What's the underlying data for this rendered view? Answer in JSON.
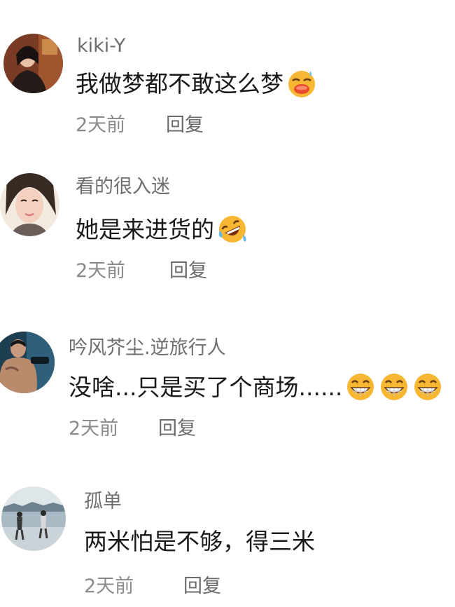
{
  "comments": [
    {
      "username": "kiki-Y",
      "text": "我做梦都不敢这么梦",
      "emojis": [
        "grimace-sweat-emoji"
      ],
      "time": "2天前",
      "reply": "回复"
    },
    {
      "username": "看的很入迷",
      "text": "她是来进货的",
      "emojis": [
        "rofl-emoji"
      ],
      "time": "2天前",
      "reply": "回复"
    },
    {
      "username": "吟风芥尘.逆旅行人",
      "text": "没啥...只是买了个商场......",
      "emojis": [
        "grin-emoji",
        "grin-emoji",
        "grin-emoji"
      ],
      "time": "2天前",
      "reply": "回复"
    },
    {
      "username": "孤单",
      "text": "两米怕是不够，得三米",
      "emojis": [],
      "time": "2天前",
      "reply": "回复"
    }
  ],
  "colors": {
    "username": "#6e6e6e",
    "text": "#1a1a1a",
    "meta": "#8a8a8a",
    "emoji_yellow": "#f7b733"
  }
}
